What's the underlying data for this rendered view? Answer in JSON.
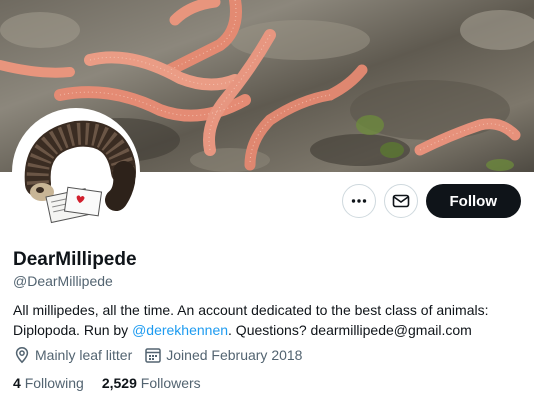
{
  "profile": {
    "display_name": "DearMillipede",
    "handle": "@DearMillipede",
    "bio_part1": "All millipedes, all the time. An account dedicated to the best class of animals: Diplopoda. Run by ",
    "bio_mention": "@derekhennen",
    "bio_part2": ". Questions? dearmillipede@gmail.com",
    "location": "Mainly leaf litter",
    "joined": "Joined February 2018"
  },
  "actions": {
    "more_icon": "more-icon",
    "message_icon": "envelope-icon",
    "follow_label": "Follow"
  },
  "stats": {
    "following_count": "4",
    "following_label": "Following",
    "followers_count": "2,529",
    "followers_label": "Followers"
  },
  "colors": {
    "accent": "#1d9bf0",
    "follow_bg": "#0f1419",
    "secondary_text": "#536471"
  }
}
